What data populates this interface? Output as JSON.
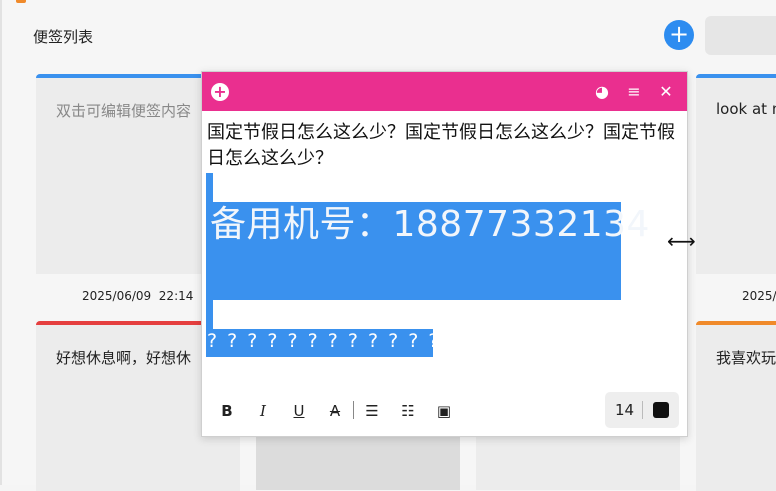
{
  "header": {
    "title": "便签列表",
    "add_icon": "plus-icon",
    "add_glyph": "+"
  },
  "cards": [
    {
      "text": "双击可编辑便签内容",
      "color": "#3a91ee",
      "date": "2025/06/09  22:14"
    },
    {
      "text": "look at m",
      "color": "#3a91ee",
      "date": "2025/"
    },
    {
      "text": "好想休息啊，好想休",
      "color": "#e53f3f"
    },
    {
      "text": "我喜欢玩",
      "color": "#f08a2a"
    }
  ],
  "note": {
    "header_color": "#ea2f8f",
    "icons": {
      "add": "plus-circle-icon",
      "palette": "palette-icon",
      "menu": "menu-icon",
      "close": "close-icon"
    },
    "glyphs": {
      "add": "+",
      "palette": "◕",
      "menu": "≡",
      "close": "✕"
    },
    "line1": "国定节假日怎么这么少？国定节假日怎么这么少？国定节假日怎么这么少？",
    "phone": "备用机号：18877332134",
    "question_line": "? ? ? ? ? ? ? ? ? ? ? ? ?",
    "selection_color": "#3a91ee",
    "toolbar": {
      "bold": "B",
      "italic": "I",
      "underline": "U",
      "strike": "A",
      "bullet_list_icon": "bullet-list-icon",
      "numbered_list_icon": "numbered-list-icon",
      "image_icon": "image-icon",
      "bullet_glyph": "☰",
      "numbered_glyph": "☷",
      "image_glyph": "▣",
      "font_size": "14",
      "text_color": "#111111"
    }
  },
  "cursor": {
    "icon": "resize-horizontal-icon",
    "glyph": "⟷"
  }
}
